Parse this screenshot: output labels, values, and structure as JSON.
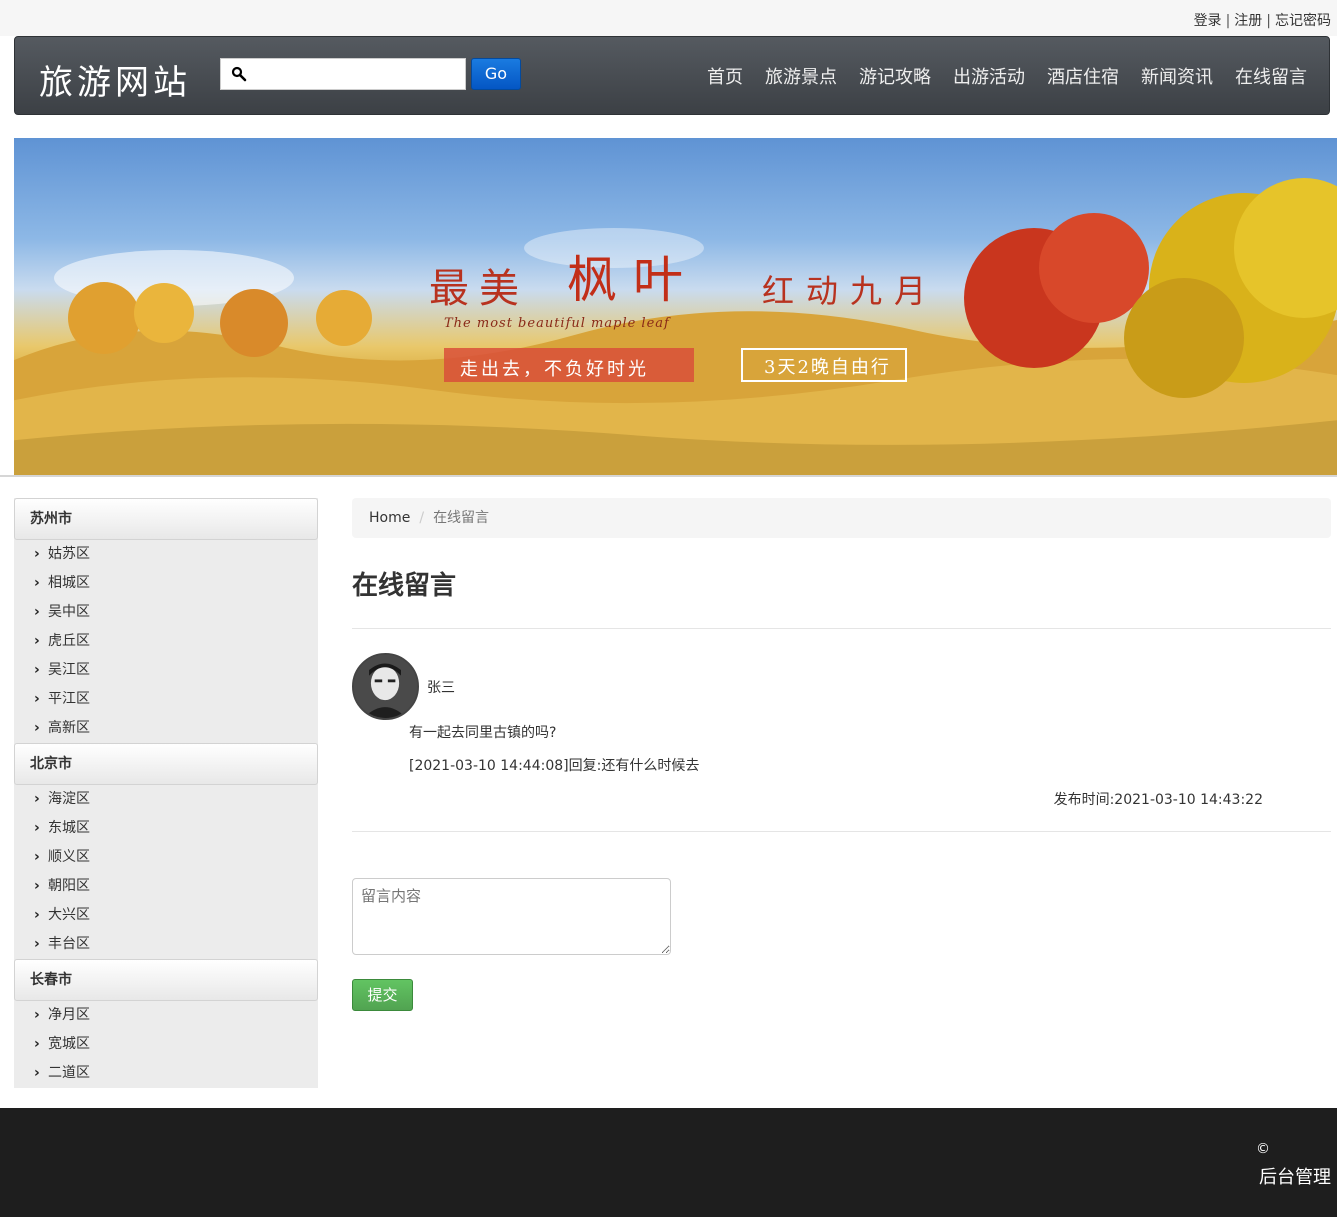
{
  "top_links": {
    "login": "登录",
    "register": "注册",
    "forgot": "忘记密码",
    "sep": "|"
  },
  "navbar": {
    "brand": "旅游网站",
    "search_placeholder": "",
    "go_label": "Go",
    "items": [
      "首页",
      "旅游景点",
      "游记攻略",
      "出游活动",
      "酒店住宿",
      "新闻资讯",
      "在线留言"
    ]
  },
  "banner": {
    "title_a": "最美",
    "title_b": "枫叶",
    "title_c": "红动九月",
    "subtitle": "The most beautiful maple leaf",
    "tag1": "走出去，不负好时光",
    "tag2": "3天2晚自由行"
  },
  "sidebar": {
    "groups": [
      {
        "name": "苏州市",
        "items": [
          "姑苏区",
          "相城区",
          "吴中区",
          "虎丘区",
          "吴江区",
          "平江区",
          "高新区"
        ]
      },
      {
        "name": "北京市",
        "items": [
          "海淀区",
          "东城区",
          "顺义区",
          "朝阳区",
          "大兴区",
          "丰台区"
        ]
      },
      {
        "name": "长春市",
        "items": [
          "净月区",
          "宽城区",
          "二道区"
        ]
      }
    ]
  },
  "breadcrumb": {
    "home": "Home",
    "divider": "/",
    "current": "在线留言"
  },
  "page_title": "在线留言",
  "message": {
    "username": "张三",
    "content": "有一起去同里古镇的吗?",
    "reply": "[2021-03-10 14:44:08]回复:还有什么时候去",
    "time": "发布时间:2021-03-10 14:43:22"
  },
  "form": {
    "placeholder": "留言内容",
    "submit_label": "提交"
  },
  "footer": {
    "copyright": "©",
    "admin": "后台管理"
  }
}
